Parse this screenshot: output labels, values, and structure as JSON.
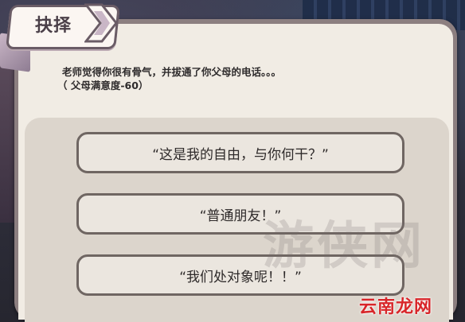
{
  "dialog": {
    "title": "抉择",
    "message": "老师觉得你很有骨气，并拔通了你父母的电话。。。",
    "effect": "（ 父母满意度-60）"
  },
  "options": [
    {
      "label": "“这是我的自由，与你何干？”"
    },
    {
      "label": "“普通朋友！”"
    },
    {
      "label": "“我们处对象呢！！”"
    }
  ],
  "watermarks": {
    "center": "游侠网",
    "corner": "云南龙网"
  },
  "colors": {
    "frame": "#8c7f80",
    "panel": "#f1ece4",
    "option_bg": "#ebe6df",
    "option_border": "#6f6662",
    "logo_red": "#d8262a"
  }
}
